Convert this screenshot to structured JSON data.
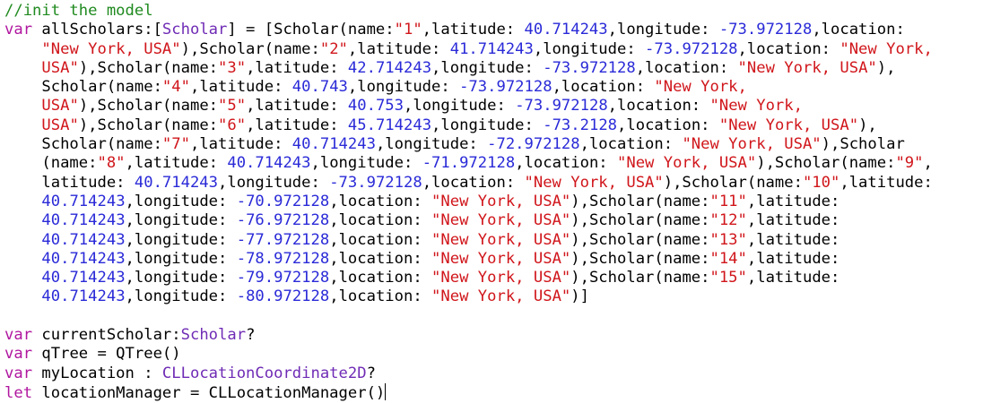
{
  "editor": {
    "lines": [
      [
        [
          "comment",
          "//init the model"
        ]
      ],
      [
        [
          "keyword",
          "var"
        ],
        [
          "plain",
          " allScholars:["
        ],
        [
          "type",
          "Scholar"
        ],
        [
          "plain",
          "] = [Scholar(name:"
        ],
        [
          "string",
          "\"1\""
        ],
        [
          "plain",
          ",latitude: "
        ],
        [
          "number",
          "40.714243"
        ],
        [
          "plain",
          ",longitude: "
        ],
        [
          "number",
          "-73.972128"
        ],
        [
          "plain",
          ",location:"
        ]
      ],
      [
        [
          "plain",
          "    "
        ],
        [
          "string",
          "\"New York, USA\""
        ],
        [
          "plain",
          "),Scholar(name:"
        ],
        [
          "string",
          "\"2\""
        ],
        [
          "plain",
          ",latitude: "
        ],
        [
          "number",
          "41.714243"
        ],
        [
          "plain",
          ",longitude: "
        ],
        [
          "number",
          "-73.972128"
        ],
        [
          "plain",
          ",location: "
        ],
        [
          "string",
          "\"New York,"
        ]
      ],
      [
        [
          "plain",
          "    "
        ],
        [
          "string",
          "USA\""
        ],
        [
          "plain",
          "),Scholar(name:"
        ],
        [
          "string",
          "\"3\""
        ],
        [
          "plain",
          ",latitude: "
        ],
        [
          "number",
          "42.714243"
        ],
        [
          "plain",
          ",longitude: "
        ],
        [
          "number",
          "-73.972128"
        ],
        [
          "plain",
          ",location: "
        ],
        [
          "string",
          "\"New York, USA\""
        ],
        [
          "plain",
          "),"
        ]
      ],
      [
        [
          "plain",
          "    Scholar(name:"
        ],
        [
          "string",
          "\"4\""
        ],
        [
          "plain",
          ",latitude: "
        ],
        [
          "number",
          "40.743"
        ],
        [
          "plain",
          ",longitude: "
        ],
        [
          "number",
          "-73.972128"
        ],
        [
          "plain",
          ",location: "
        ],
        [
          "string",
          "\"New York,"
        ]
      ],
      [
        [
          "plain",
          "    "
        ],
        [
          "string",
          "USA\""
        ],
        [
          "plain",
          "),Scholar(name:"
        ],
        [
          "string",
          "\"5\""
        ],
        [
          "plain",
          ",latitude: "
        ],
        [
          "number",
          "40.753"
        ],
        [
          "plain",
          ",longitude: "
        ],
        [
          "number",
          "-73.972128"
        ],
        [
          "plain",
          ",location: "
        ],
        [
          "string",
          "\"New York,"
        ]
      ],
      [
        [
          "plain",
          "    "
        ],
        [
          "string",
          "USA\""
        ],
        [
          "plain",
          "),Scholar(name:"
        ],
        [
          "string",
          "\"6\""
        ],
        [
          "plain",
          ",latitude: "
        ],
        [
          "number",
          "45.714243"
        ],
        [
          "plain",
          ",longitude: "
        ],
        [
          "number",
          "-73.2128"
        ],
        [
          "plain",
          ",location: "
        ],
        [
          "string",
          "\"New York, USA\""
        ],
        [
          "plain",
          "),"
        ]
      ],
      [
        [
          "plain",
          "    Scholar(name:"
        ],
        [
          "string",
          "\"7\""
        ],
        [
          "plain",
          ",latitude: "
        ],
        [
          "number",
          "40.714243"
        ],
        [
          "plain",
          ",longitude: "
        ],
        [
          "number",
          "-72.972128"
        ],
        [
          "plain",
          ",location: "
        ],
        [
          "string",
          "\"New York, USA\""
        ],
        [
          "plain",
          "),Scholar"
        ]
      ],
      [
        [
          "plain",
          "    (name:"
        ],
        [
          "string",
          "\"8\""
        ],
        [
          "plain",
          ",latitude: "
        ],
        [
          "number",
          "40.714243"
        ],
        [
          "plain",
          ",longitude: "
        ],
        [
          "number",
          "-71.972128"
        ],
        [
          "plain",
          ",location: "
        ],
        [
          "string",
          "\"New York, USA\""
        ],
        [
          "plain",
          "),Scholar(name:"
        ],
        [
          "string",
          "\"9\""
        ],
        [
          "plain",
          ","
        ]
      ],
      [
        [
          "plain",
          "    latitude: "
        ],
        [
          "number",
          "40.714243"
        ],
        [
          "plain",
          ",longitude: "
        ],
        [
          "number",
          "-73.972128"
        ],
        [
          "plain",
          ",location: "
        ],
        [
          "string",
          "\"New York, USA\""
        ],
        [
          "plain",
          "),Scholar(name:"
        ],
        [
          "string",
          "\"10\""
        ],
        [
          "plain",
          ",latitude:"
        ]
      ],
      [
        [
          "plain",
          "    "
        ],
        [
          "number",
          "40.714243"
        ],
        [
          "plain",
          ",longitude: "
        ],
        [
          "number",
          "-70.972128"
        ],
        [
          "plain",
          ",location: "
        ],
        [
          "string",
          "\"New York, USA\""
        ],
        [
          "plain",
          "),Scholar(name:"
        ],
        [
          "string",
          "\"11\""
        ],
        [
          "plain",
          ",latitude:"
        ]
      ],
      [
        [
          "plain",
          "    "
        ],
        [
          "number",
          "40.714243"
        ],
        [
          "plain",
          ",longitude: "
        ],
        [
          "number",
          "-76.972128"
        ],
        [
          "plain",
          ",location: "
        ],
        [
          "string",
          "\"New York, USA\""
        ],
        [
          "plain",
          "),Scholar(name:"
        ],
        [
          "string",
          "\"12\""
        ],
        [
          "plain",
          ",latitude:"
        ]
      ],
      [
        [
          "plain",
          "    "
        ],
        [
          "number",
          "40.714243"
        ],
        [
          "plain",
          ",longitude: "
        ],
        [
          "number",
          "-77.972128"
        ],
        [
          "plain",
          ",location: "
        ],
        [
          "string",
          "\"New York, USA\""
        ],
        [
          "plain",
          "),Scholar(name:"
        ],
        [
          "string",
          "\"13\""
        ],
        [
          "plain",
          ",latitude:"
        ]
      ],
      [
        [
          "plain",
          "    "
        ],
        [
          "number",
          "40.714243"
        ],
        [
          "plain",
          ",longitude: "
        ],
        [
          "number",
          "-78.972128"
        ],
        [
          "plain",
          ",location: "
        ],
        [
          "string",
          "\"New York, USA\""
        ],
        [
          "plain",
          "),Scholar(name:"
        ],
        [
          "string",
          "\"14\""
        ],
        [
          "plain",
          ",latitude:"
        ]
      ],
      [
        [
          "plain",
          "    "
        ],
        [
          "number",
          "40.714243"
        ],
        [
          "plain",
          ",longitude: "
        ],
        [
          "number",
          "-79.972128"
        ],
        [
          "plain",
          ",location: "
        ],
        [
          "string",
          "\"New York, USA\""
        ],
        [
          "plain",
          "),Scholar(name:"
        ],
        [
          "string",
          "\"15\""
        ],
        [
          "plain",
          ",latitude:"
        ]
      ],
      [
        [
          "plain",
          "    "
        ],
        [
          "number",
          "40.714243"
        ],
        [
          "plain",
          ",longitude: "
        ],
        [
          "number",
          "-80.972128"
        ],
        [
          "plain",
          ",location: "
        ],
        [
          "string",
          "\"New York, USA\""
        ],
        [
          "plain",
          ")]"
        ]
      ],
      [],
      [
        [
          "keyword",
          "var"
        ],
        [
          "plain",
          " currentScholar:"
        ],
        [
          "type",
          "Scholar"
        ],
        [
          "plain",
          "?"
        ]
      ],
      [
        [
          "keyword",
          "var"
        ],
        [
          "plain",
          " qTree = QTree()"
        ]
      ],
      [
        [
          "keyword",
          "var"
        ],
        [
          "plain",
          " myLocation : "
        ],
        [
          "type",
          "CLLocationCoordinate2D"
        ],
        [
          "plain",
          "?"
        ]
      ],
      [
        [
          "keyword",
          "let"
        ],
        [
          "plain",
          " locationManager = CLLocationManager()"
        ]
      ]
    ]
  },
  "colors": {
    "comment": "#1f8a1f",
    "keyword": "#b0169f",
    "type": "#6f2bb5",
    "string": "#d0161b",
    "number": "#2a2ad8",
    "plain": "#000000",
    "background": "#ffffff"
  }
}
